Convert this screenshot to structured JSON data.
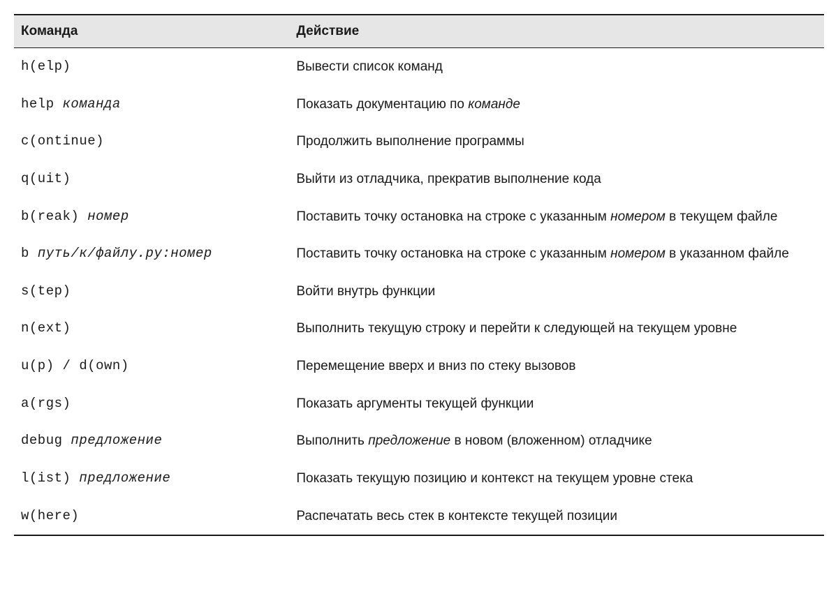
{
  "headers": {
    "command": "Команда",
    "action": "Действие"
  },
  "rows": [
    {
      "cmd_parts": [
        {
          "t": "mono",
          "v": "h(elp)"
        }
      ],
      "act_parts": [
        {
          "t": "text",
          "v": "Вывести список команд"
        }
      ]
    },
    {
      "cmd_parts": [
        {
          "t": "mono",
          "v": "help "
        },
        {
          "t": "mono-italic",
          "v": "команда"
        }
      ],
      "act_parts": [
        {
          "t": "text",
          "v": "Показать документацию по "
        },
        {
          "t": "sans-italic",
          "v": "команде"
        }
      ]
    },
    {
      "cmd_parts": [
        {
          "t": "mono",
          "v": "c(ontinue)"
        }
      ],
      "act_parts": [
        {
          "t": "text",
          "v": "Продолжить выполнение программы"
        }
      ]
    },
    {
      "cmd_parts": [
        {
          "t": "mono",
          "v": "q(uit)"
        }
      ],
      "act_parts": [
        {
          "t": "text",
          "v": "Выйти из отладчика, прекратив выполнение кода"
        }
      ]
    },
    {
      "cmd_parts": [
        {
          "t": "mono",
          "v": "b(reak) "
        },
        {
          "t": "mono-italic",
          "v": "номер"
        }
      ],
      "act_parts": [
        {
          "t": "text",
          "v": "Поставить точку остановка на строке с указанным "
        },
        {
          "t": "sans-italic",
          "v": "номером"
        },
        {
          "t": "text",
          "v": " в текущем файле"
        }
      ]
    },
    {
      "cmd_parts": [
        {
          "t": "mono",
          "v": "b "
        },
        {
          "t": "mono-italic",
          "v": "путь/к/файлу.py:номер"
        }
      ],
      "act_parts": [
        {
          "t": "text",
          "v": "Поставить точку остановка на строке с указанным "
        },
        {
          "t": "sans-italic",
          "v": "номером"
        },
        {
          "t": "text",
          "v": " в указанном файле"
        }
      ]
    },
    {
      "cmd_parts": [
        {
          "t": "mono",
          "v": "s(tep)"
        }
      ],
      "act_parts": [
        {
          "t": "text",
          "v": "Войти внутрь функции"
        }
      ]
    },
    {
      "cmd_parts": [
        {
          "t": "mono",
          "v": "n(ext)"
        }
      ],
      "act_parts": [
        {
          "t": "text",
          "v": "Выполнить текущую строку и перейти к следующей на текущем уровне"
        }
      ]
    },
    {
      "cmd_parts": [
        {
          "t": "mono",
          "v": "u(p) / d(own)"
        }
      ],
      "act_parts": [
        {
          "t": "text",
          "v": "Перемещение вверх и вниз по стеку вызовов"
        }
      ]
    },
    {
      "cmd_parts": [
        {
          "t": "mono",
          "v": "a(rgs)"
        }
      ],
      "act_parts": [
        {
          "t": "text",
          "v": "Показать аргументы текущей функции"
        }
      ]
    },
    {
      "cmd_parts": [
        {
          "t": "mono",
          "v": "debug "
        },
        {
          "t": "mono-italic",
          "v": "предложение"
        }
      ],
      "act_parts": [
        {
          "t": "text",
          "v": "Выполнить "
        },
        {
          "t": "sans-italic",
          "v": "предложение"
        },
        {
          "t": "text",
          "v": " в новом (вложенном) отладчике"
        }
      ]
    },
    {
      "cmd_parts": [
        {
          "t": "mono",
          "v": "l(ist) "
        },
        {
          "t": "mono-italic",
          "v": "предложение"
        }
      ],
      "act_parts": [
        {
          "t": "text",
          "v": "Показать текущую позицию и контекст  на текущем уровне стека"
        }
      ]
    },
    {
      "cmd_parts": [
        {
          "t": "mono",
          "v": "w(here)"
        }
      ],
      "act_parts": [
        {
          "t": "text",
          "v": "Распечатать весь стек в контексте текущей позиции"
        }
      ]
    }
  ]
}
